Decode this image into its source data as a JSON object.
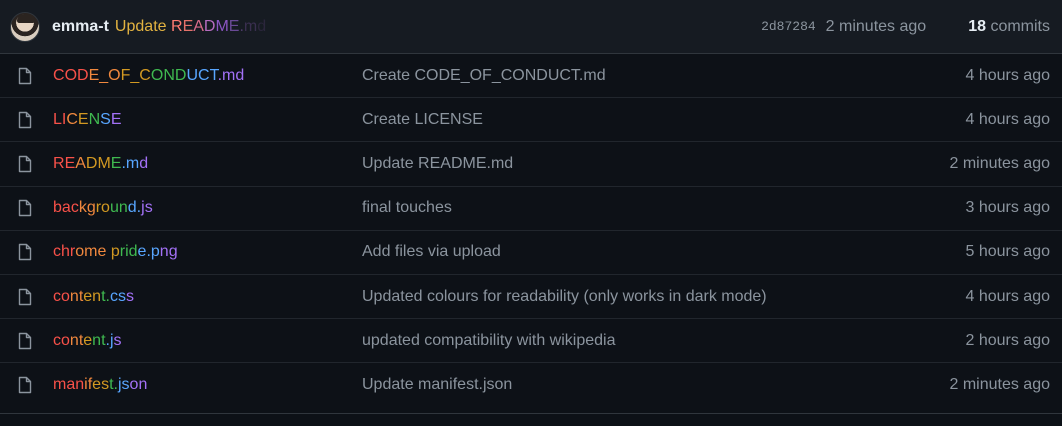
{
  "commit": {
    "author": "emma-t",
    "message": "Update README.md",
    "sha": "2d87284",
    "time": "2 minutes ago",
    "commits_count": "18",
    "commits_label": "commits"
  },
  "files": [
    {
      "name": "CODE_OF_CONDUCT.md",
      "message": "Create CODE_OF_CONDUCT.md",
      "time": "4 hours ago"
    },
    {
      "name": "LICENSE",
      "message": "Create LICENSE",
      "time": "4 hours ago"
    },
    {
      "name": "README.md",
      "message": "Update README.md",
      "time": "2 minutes ago"
    },
    {
      "name": "background.js",
      "message": "final touches",
      "time": "3 hours ago"
    },
    {
      "name": "chrome pride.png",
      "message": "Add files via upload",
      "time": "5 hours ago"
    },
    {
      "name": "content.css",
      "message": "Updated colours for readability (only works in dark mode)",
      "time": "4 hours ago"
    },
    {
      "name": "content.js",
      "message": "updated compatibility with wikipedia",
      "time": "2 hours ago"
    },
    {
      "name": "manifest.json",
      "message": "Update manifest.json",
      "time": "2 minutes ago"
    }
  ],
  "colors": {
    "background": "#0d1117",
    "header": "#161b22",
    "muted": "#8b949e",
    "rainbow": [
      "#f85149",
      "#f0883e",
      "#d29922",
      "#3fb950",
      "#58a6ff",
      "#a371f7"
    ]
  },
  "icons": {
    "file": "file-icon",
    "avatar": "user-avatar"
  }
}
